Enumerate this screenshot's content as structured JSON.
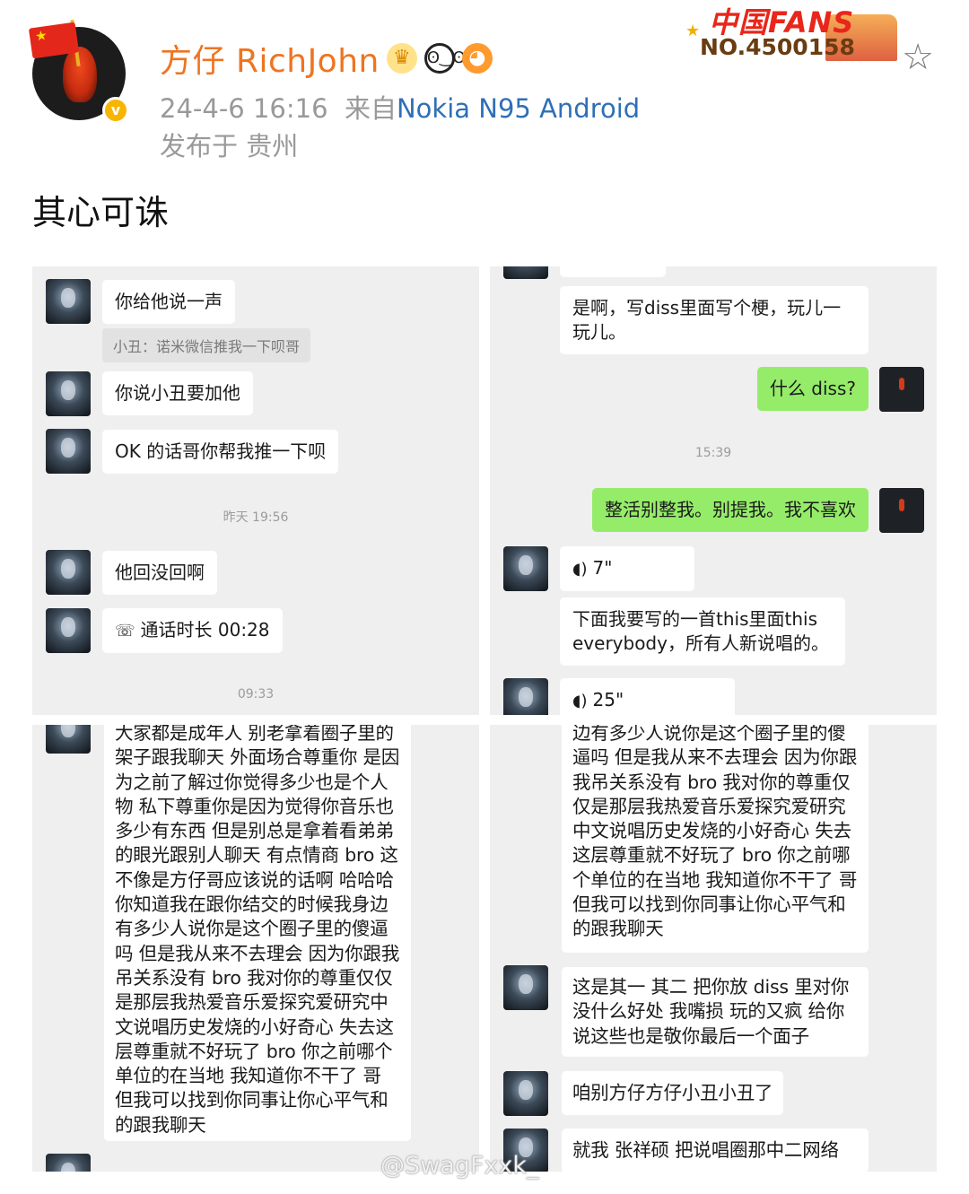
{
  "post": {
    "username": "方仔 RichJohn",
    "timestamp": "24-4-6 16:16",
    "source_prefix": "来自",
    "device": "Nokia N95 Android",
    "location": "发布于 贵州",
    "text": "其心可诛",
    "fans_badge_title": "中国FANS",
    "fans_badge_number": "NO.4500158",
    "badges": [
      "crown-icon",
      "panda-icon",
      "fish-icon"
    ]
  },
  "panel1": {
    "m1": "你给他说一声",
    "quote": "小丑：诺米微信推我一下呗哥",
    "m2": "你说小丑要加他",
    "m3": "OK 的话哥你帮我推一下呗",
    "time1": "昨天 19:56",
    "m4": "他回没回啊",
    "call": "通话时长 00:28",
    "time2": "09:33"
  },
  "panel2": {
    "m1": "是啊，写diss里面写个梗，玩儿一玩儿。",
    "m2": "什么 diss?",
    "time1": "15:39",
    "m3": "整活别整我。别提我。我不喜欢",
    "voice1": "7\"",
    "m4": "下面我要写的一首this里面this everybody，所有人新说唱的。",
    "voice2": "25\""
  },
  "panel3": {
    "long": "大家都是成年人 别老拿着圈子里的架子跟我聊天 外面场合尊重你 是因为之前了解过你觉得多少也是个人物 私下尊重你是因为觉得你音乐也多少有东西 但是别总是拿着看弟弟的眼光跟别人聊天 有点情商 bro 这不像是方仔哥应该说的话啊 哈哈哈 你知道我在跟你结交的时候我身边有多少人说你是这个圈子里的傻逼吗 但是我从来不去理会 因为你跟我吊关系没有 bro 我对你的尊重仅仅是那层我热爱音乐爱探究爱研究中文说唱历史发烧的小好奇心 失去这层尊重就不好玩了 bro 你之前哪个单位的在当地 我知道你不干了 哥 但我可以找到你同事让你心平气和的跟我聊天"
  },
  "panel4": {
    "long": "边有多少人说你是这个圈子里的傻逼吗 但是我从来不去理会 因为你跟我吊关系没有 bro 我对你的尊重仅仅是那层我热爱音乐爱探究爱研究中文说唱历史发烧的小好奇心 失去这层尊重就不好玩了 bro 你之前哪个单位的在当地 我知道你不干了 哥 但我可以找到你同事让你心平气和的跟我聊天",
    "m2": "这是其一 其二 把你放 diss 里对你没什么好处 我嘴损 玩的又疯 给你说这些也是敬你最后一个面子",
    "m3": "咱别方仔方仔小丑小丑了",
    "m4": "就我 张祥硕 把说唱圈那中二网络"
  },
  "watermark": "@SwagFxxk_"
}
